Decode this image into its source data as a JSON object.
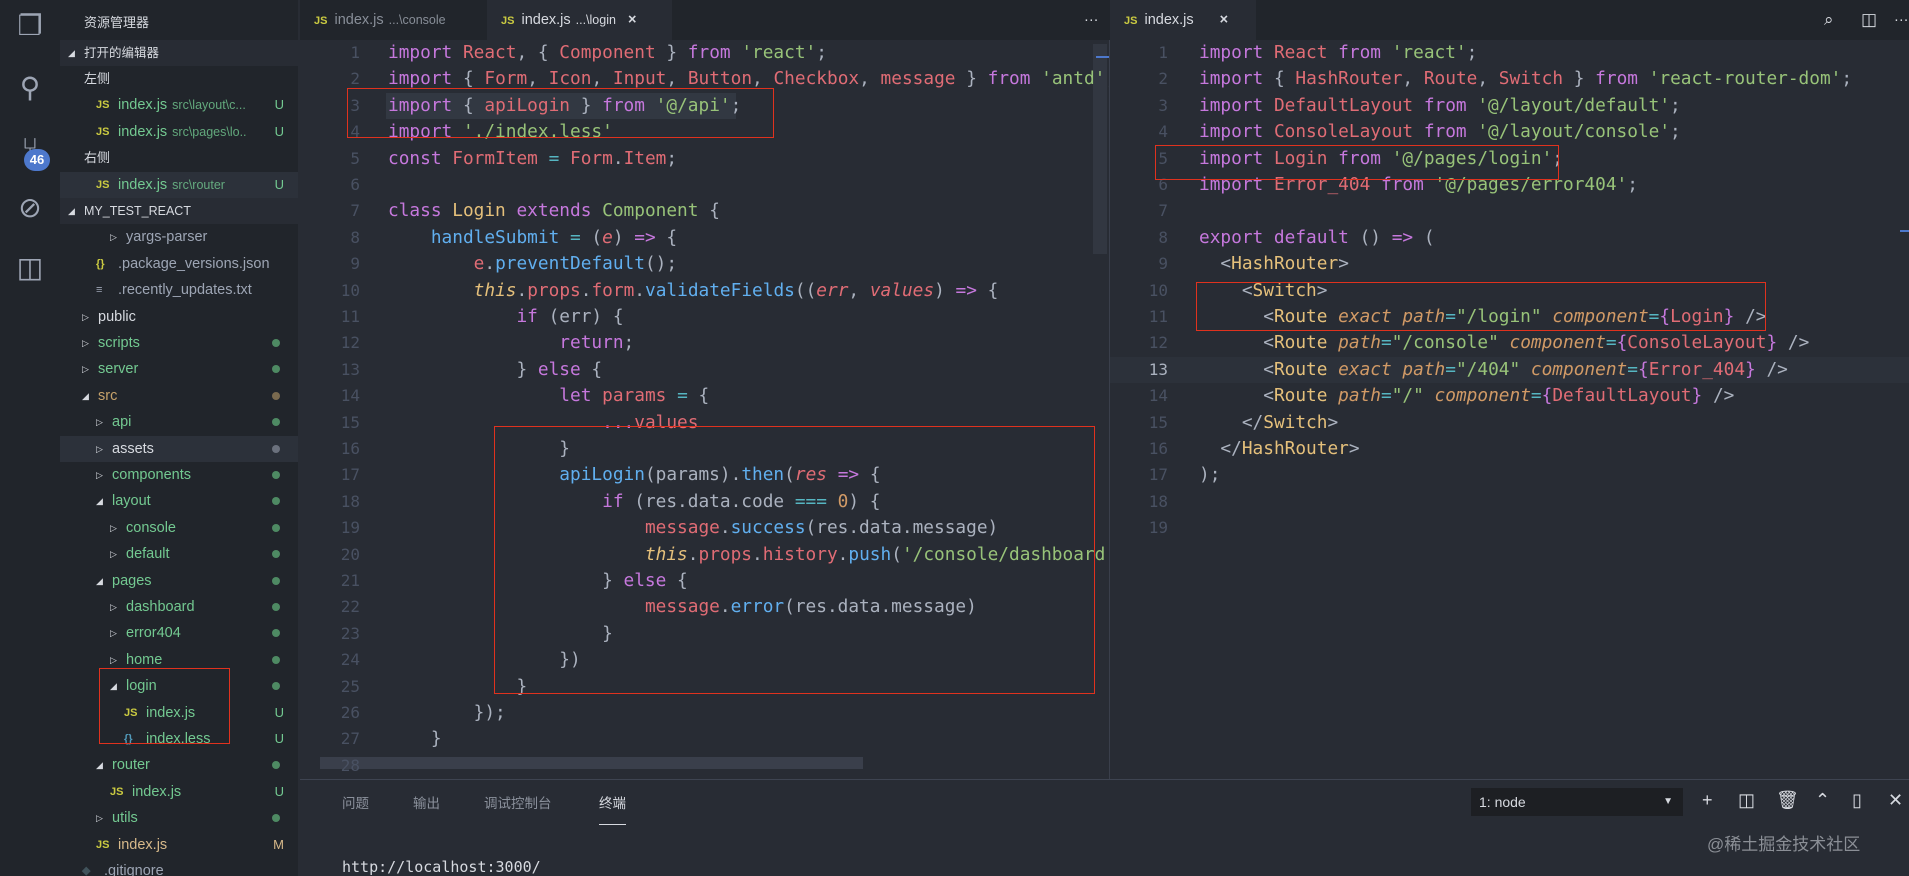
{
  "colors": {
    "accent": "#4d78cc",
    "bg": "#282c34",
    "sidebar": "#21252b",
    "git_untracked": "#73c991",
    "git_modified": "#d7b98a",
    "highlight_box": "#e0321e"
  },
  "activity_bar": {
    "icons": [
      "files-icon",
      "search-icon",
      "source-control-icon",
      "debug-icon",
      "extensions-icon"
    ],
    "scm_badge": "46"
  },
  "sidebar": {
    "title": "资源管理器",
    "open_editors_label": "打开的编辑器",
    "project_label": "MY_TEST_REACT",
    "rows": [
      {
        "type": "group",
        "label": "左侧"
      },
      {
        "type": "file",
        "label": "index.js",
        "sub": "src\\layout\\c...",
        "status": "U",
        "icon": "js",
        "indent": 2,
        "color": "#73c991"
      },
      {
        "type": "file",
        "label": "index.js",
        "sub": "src\\pages\\lo..",
        "status": "U",
        "icon": "js",
        "indent": 2,
        "color": "#73c991"
      },
      {
        "type": "group",
        "label": "右侧"
      },
      {
        "type": "file",
        "label": "index.js",
        "sub": "src\\router",
        "status": "U",
        "icon": "js",
        "indent": 2,
        "color": "#73c991",
        "selected": true
      },
      {
        "type": "section",
        "label": "MY_TEST_REACT"
      },
      {
        "type": "folder",
        "label": "yargs-parser",
        "indent": 3,
        "color": "#9da5b4",
        "open": false
      },
      {
        "type": "file",
        "label": ".package_versions.json",
        "icon": "json",
        "indent": 2,
        "color": "#9da5b4"
      },
      {
        "type": "file",
        "label": ".recently_updates.txt",
        "icon": "txt",
        "indent": 2,
        "color": "#9da5b4"
      },
      {
        "type": "folder",
        "label": "public",
        "indent": 1,
        "color": "#d7dae0",
        "open": false
      },
      {
        "type": "folder",
        "label": "scripts",
        "indent": 1,
        "color": "#73c991",
        "dot": "#4e8a63",
        "open": false
      },
      {
        "type": "folder",
        "label": "server",
        "indent": 1,
        "color": "#73c991",
        "dot": "#4e8a63",
        "open": false
      },
      {
        "type": "folder",
        "label": "src",
        "indent": 1,
        "color": "#c6a26b",
        "dot": "#7a6a4f",
        "open": true
      },
      {
        "type": "folder",
        "label": "api",
        "indent": 2,
        "color": "#73c991",
        "dot": "#4e8a63",
        "open": false
      },
      {
        "type": "folder",
        "label": "assets",
        "indent": 2,
        "color": "#d7dae0",
        "dot": "#6b717d",
        "open": false,
        "selected": true
      },
      {
        "type": "folder",
        "label": "components",
        "indent": 2,
        "color": "#73c991",
        "dot": "#4e8a63",
        "open": false
      },
      {
        "type": "folder",
        "label": "layout",
        "indent": 2,
        "color": "#73c991",
        "dot": "#4e8a63",
        "open": true
      },
      {
        "type": "folder",
        "label": "console",
        "indent": 3,
        "color": "#73c991",
        "dot": "#4e8a63",
        "open": false
      },
      {
        "type": "folder",
        "label": "default",
        "indent": 3,
        "color": "#73c991",
        "dot": "#4e8a63",
        "open": false
      },
      {
        "type": "folder",
        "label": "pages",
        "indent": 2,
        "color": "#73c991",
        "dot": "#4e8a63",
        "open": true
      },
      {
        "type": "folder",
        "label": "dashboard",
        "indent": 3,
        "color": "#73c991",
        "dot": "#4e8a63",
        "open": false
      },
      {
        "type": "folder",
        "label": "error404",
        "indent": 3,
        "color": "#73c991",
        "dot": "#4e8a63",
        "open": false
      },
      {
        "type": "folder",
        "label": "home",
        "indent": 3,
        "color": "#73c991",
        "dot": "#4e8a63",
        "open": false
      },
      {
        "type": "folder",
        "label": "login",
        "indent": 3,
        "color": "#73c991",
        "dot": "#4e8a63",
        "open": true
      },
      {
        "type": "file",
        "label": "index.js",
        "icon": "js",
        "indent": 4,
        "color": "#73c991",
        "status": "U"
      },
      {
        "type": "file",
        "label": "index.less",
        "icon": "less",
        "indent": 4,
        "color": "#73c991",
        "status": "U"
      },
      {
        "type": "folder",
        "label": "router",
        "indent": 2,
        "color": "#73c991",
        "dot": "#4e8a63",
        "open": true
      },
      {
        "type": "file",
        "label": "index.js",
        "icon": "js",
        "indent": 3,
        "color": "#73c991",
        "status": "U"
      },
      {
        "type": "folder",
        "label": "utils",
        "indent": 2,
        "color": "#73c991",
        "dot": "#4e8a63",
        "open": false
      },
      {
        "type": "file",
        "label": "index.js",
        "icon": "js",
        "indent": 2,
        "color": "#d7b98a",
        "status": "M"
      },
      {
        "type": "file",
        "label": ".gitignore",
        "icon": "git",
        "indent": 1,
        "color": "#9da5b4"
      }
    ]
  },
  "editor_left": {
    "tabs": [
      {
        "label": "index.js",
        "dir": "...\\console",
        "active": false
      },
      {
        "label": "index.js",
        "dir": "...\\login",
        "active": true,
        "close": "×"
      }
    ],
    "more": "···",
    "lines": [
      [
        [
          "k",
          "import "
        ],
        [
          "v",
          "React"
        ],
        [
          "p",
          ", { "
        ],
        [
          "v",
          "Component"
        ],
        [
          "p",
          " } "
        ],
        [
          "k",
          "from "
        ],
        [
          "s",
          "'react'"
        ],
        [
          "p",
          ";"
        ]
      ],
      [
        [
          "k",
          "import "
        ],
        [
          "p",
          "{ "
        ],
        [
          "v",
          "Form"
        ],
        [
          "p",
          ", "
        ],
        [
          "v",
          "Icon"
        ],
        [
          "p",
          ", "
        ],
        [
          "v",
          "Input"
        ],
        [
          "p",
          ", "
        ],
        [
          "v",
          "Button"
        ],
        [
          "p",
          ", "
        ],
        [
          "v",
          "Checkbox"
        ],
        [
          "p",
          ", "
        ],
        [
          "v",
          "message"
        ],
        [
          "p",
          " } "
        ],
        [
          "k",
          "from "
        ],
        [
          "s",
          "'antd'"
        ],
        [
          "p",
          ";"
        ]
      ],
      [
        [
          "k",
          "import "
        ],
        [
          "p",
          "{ "
        ],
        [
          "v",
          "apiLogin"
        ],
        [
          "p",
          " } "
        ],
        [
          "k",
          "from "
        ],
        [
          "s",
          "'@/api'"
        ],
        [
          "p",
          ";"
        ]
      ],
      [
        [
          "k",
          "import "
        ],
        [
          "s",
          "'./index.less'"
        ]
      ],
      [
        [
          "k",
          "const "
        ],
        [
          "v",
          "FormItem"
        ],
        [
          "e",
          " = "
        ],
        [
          "v",
          "Form"
        ],
        [
          "p",
          "."
        ],
        [
          "v",
          "Item"
        ],
        [
          "p",
          ";"
        ]
      ],
      [],
      [
        [
          "k",
          "class "
        ],
        [
          "c",
          "Login "
        ],
        [
          "k",
          "extends "
        ],
        [
          "g",
          "Component "
        ],
        [
          "p",
          "{"
        ]
      ],
      [
        [
          "p",
          "    "
        ],
        [
          "f",
          "handleSubmit"
        ],
        [
          "e",
          " = "
        ],
        [
          "p",
          "("
        ],
        [
          "i",
          "e"
        ],
        [
          "p",
          ") "
        ],
        [
          "k",
          "=> "
        ],
        [
          "p",
          "{"
        ]
      ],
      [
        [
          "p",
          "        "
        ],
        [
          "v",
          "e"
        ],
        [
          "p",
          "."
        ],
        [
          "f",
          "preventDefault"
        ],
        [
          "p",
          "();"
        ]
      ],
      [
        [
          "p",
          "        "
        ],
        [
          "t",
          "this"
        ],
        [
          "p",
          "."
        ],
        [
          "v",
          "props"
        ],
        [
          "p",
          "."
        ],
        [
          "v",
          "form"
        ],
        [
          "p",
          "."
        ],
        [
          "f",
          "validateFields"
        ],
        [
          "p",
          "(("
        ],
        [
          "i",
          "err"
        ],
        [
          "p",
          ", "
        ],
        [
          "i",
          "values"
        ],
        [
          "p",
          ") "
        ],
        [
          "k",
          "=> "
        ],
        [
          "p",
          "{"
        ]
      ],
      [
        [
          "p",
          "            "
        ],
        [
          "k",
          "if "
        ],
        [
          "p",
          "(err) {"
        ]
      ],
      [
        [
          "p",
          "                "
        ],
        [
          "k",
          "return"
        ],
        [
          "p",
          ";"
        ]
      ],
      [
        [
          "p",
          "            } "
        ],
        [
          "k",
          "else "
        ],
        [
          "p",
          "{"
        ]
      ],
      [
        [
          "p",
          "                "
        ],
        [
          "k",
          "let "
        ],
        [
          "v",
          "params"
        ],
        [
          "e",
          " = "
        ],
        [
          "p",
          "{"
        ]
      ],
      [
        [
          "p",
          "                    "
        ],
        [
          "k",
          "..."
        ],
        [
          "v",
          "values"
        ]
      ],
      [
        [
          "p",
          "                }"
        ]
      ],
      [
        [
          "p",
          "                "
        ],
        [
          "f",
          "apiLogin"
        ],
        [
          "p",
          "(params)."
        ],
        [
          "f",
          "then"
        ],
        [
          "p",
          "("
        ],
        [
          "i",
          "res"
        ],
        [
          "k",
          " => "
        ],
        [
          "p",
          "{"
        ]
      ],
      [
        [
          "p",
          "                    "
        ],
        [
          "k",
          "if "
        ],
        [
          "p",
          "(res.data.code "
        ],
        [
          "e",
          "=== "
        ],
        [
          "n",
          "0"
        ],
        [
          "p",
          ") {"
        ]
      ],
      [
        [
          "p",
          "                        "
        ],
        [
          "v",
          "message"
        ],
        [
          "p",
          "."
        ],
        [
          "f",
          "success"
        ],
        [
          "p",
          "(res.data.message)"
        ]
      ],
      [
        [
          "p",
          "                        "
        ],
        [
          "t",
          "this"
        ],
        [
          "p",
          "."
        ],
        [
          "v",
          "props"
        ],
        [
          "p",
          "."
        ],
        [
          "v",
          "history"
        ],
        [
          "p",
          "."
        ],
        [
          "f",
          "push"
        ],
        [
          "p",
          "("
        ],
        [
          "s",
          "'/console/dashboard'"
        ],
        [
          "p",
          ")"
        ]
      ],
      [
        [
          "p",
          "                    } "
        ],
        [
          "k",
          "else "
        ],
        [
          "p",
          "{"
        ]
      ],
      [
        [
          "p",
          "                        "
        ],
        [
          "v",
          "message"
        ],
        [
          "p",
          "."
        ],
        [
          "f",
          "error"
        ],
        [
          "p",
          "(res.data.message)"
        ]
      ],
      [
        [
          "p",
          "                    }"
        ]
      ],
      [
        [
          "p",
          "                })"
        ]
      ],
      [
        [
          "p",
          "            }"
        ]
      ],
      [
        [
          "p",
          "        });"
        ]
      ],
      [
        [
          "p",
          "    }"
        ]
      ],
      []
    ]
  },
  "editor_right": {
    "tab": {
      "label": "index.js",
      "close": "×"
    },
    "actions": [
      "open-preview-icon",
      "split-editor-icon",
      "more-icon"
    ],
    "more": "···",
    "current_line": 13,
    "lines": [
      [
        [
          "k",
          "import "
        ],
        [
          "v",
          "React "
        ],
        [
          "k",
          "from "
        ],
        [
          "s",
          "'react'"
        ],
        [
          "p",
          ";"
        ]
      ],
      [
        [
          "k",
          "import "
        ],
        [
          "p",
          "{ "
        ],
        [
          "v",
          "HashRouter"
        ],
        [
          "p",
          ", "
        ],
        [
          "v",
          "Route"
        ],
        [
          "p",
          ", "
        ],
        [
          "v",
          "Switch"
        ],
        [
          "p",
          " } "
        ],
        [
          "k",
          "from "
        ],
        [
          "s",
          "'react-router-dom'"
        ],
        [
          "p",
          ";"
        ]
      ],
      [
        [
          "k",
          "import "
        ],
        [
          "v",
          "DefaultLayout "
        ],
        [
          "k",
          "from "
        ],
        [
          "s",
          "'@/layout/default'"
        ],
        [
          "p",
          ";"
        ]
      ],
      [
        [
          "k",
          "import "
        ],
        [
          "v",
          "ConsoleLayout "
        ],
        [
          "k",
          "from "
        ],
        [
          "s",
          "'@/layout/console'"
        ],
        [
          "p",
          ";"
        ]
      ],
      [
        [
          "k",
          "import "
        ],
        [
          "v",
          "Login "
        ],
        [
          "k",
          "from "
        ],
        [
          "s",
          "'@/pages/login'"
        ],
        [
          "p",
          ";"
        ]
      ],
      [
        [
          "k",
          "import "
        ],
        [
          "v",
          "Error_404 "
        ],
        [
          "k",
          "from "
        ],
        [
          "s",
          "'@/pages/error404'"
        ],
        [
          "p",
          ";"
        ]
      ],
      [],
      [
        [
          "k",
          "export default "
        ],
        [
          "p",
          "() "
        ],
        [
          "k",
          "=> "
        ],
        [
          "p",
          "("
        ]
      ],
      [
        [
          "p",
          "  <"
        ],
        [
          "tg",
          "HashRouter"
        ],
        [
          "p",
          ">"
        ]
      ],
      [
        [
          "p",
          "    <"
        ],
        [
          "tg",
          "Switch"
        ],
        [
          "p",
          ">"
        ]
      ],
      [
        [
          "p",
          "      <"
        ],
        [
          "tg",
          "Route "
        ],
        [
          "a",
          "exact path"
        ],
        [
          "e",
          "="
        ],
        [
          "s",
          "\"/login\" "
        ],
        [
          "a",
          "component"
        ],
        [
          "e",
          "="
        ],
        [
          "k",
          "{"
        ],
        [
          "v",
          "Login"
        ],
        [
          "k",
          "}"
        ],
        [
          "p",
          " />"
        ]
      ],
      [
        [
          "p",
          "      <"
        ],
        [
          "tg",
          "Route "
        ],
        [
          "a",
          "path"
        ],
        [
          "e",
          "="
        ],
        [
          "s",
          "\"/console\" "
        ],
        [
          "a",
          "component"
        ],
        [
          "e",
          "="
        ],
        [
          "k",
          "{"
        ],
        [
          "v",
          "ConsoleLayout"
        ],
        [
          "k",
          "}"
        ],
        [
          "p",
          " />"
        ]
      ],
      [
        [
          "p",
          "      <"
        ],
        [
          "tg",
          "Route "
        ],
        [
          "a",
          "exact path"
        ],
        [
          "e",
          "="
        ],
        [
          "s",
          "\"/404\" "
        ],
        [
          "a",
          "component"
        ],
        [
          "e",
          "="
        ],
        [
          "k",
          "{"
        ],
        [
          "v",
          "Error_404"
        ],
        [
          "k",
          "}"
        ],
        [
          "p",
          " />"
        ]
      ],
      [
        [
          "p",
          "      <"
        ],
        [
          "tg",
          "Route "
        ],
        [
          "a",
          "path"
        ],
        [
          "e",
          "="
        ],
        [
          "s",
          "\"/\" "
        ],
        [
          "a",
          "component"
        ],
        [
          "e",
          "="
        ],
        [
          "k",
          "{"
        ],
        [
          "v",
          "DefaultLayout"
        ],
        [
          "k",
          "}"
        ],
        [
          "p",
          " />"
        ]
      ],
      [
        [
          "p",
          "    </"
        ],
        [
          "tg",
          "Switch"
        ],
        [
          "p",
          ">"
        ]
      ],
      [
        [
          "p",
          "  </"
        ],
        [
          "tg",
          "HashRouter"
        ],
        [
          "p",
          ">"
        ]
      ],
      [
        [
          "p",
          ");"
        ]
      ],
      [],
      []
    ]
  },
  "panel": {
    "tabs": [
      "问题",
      "输出",
      "调试控制台",
      "终端"
    ],
    "active_tab": "终端",
    "terminal_select": "1: node",
    "actions": [
      "add-icon",
      "split-icon",
      "trash-icon",
      "maximize-icon",
      "layout-icon",
      "close-icon"
    ],
    "output": "http://localhost:3000/"
  },
  "watermark": "@稀土掘金技术社区"
}
